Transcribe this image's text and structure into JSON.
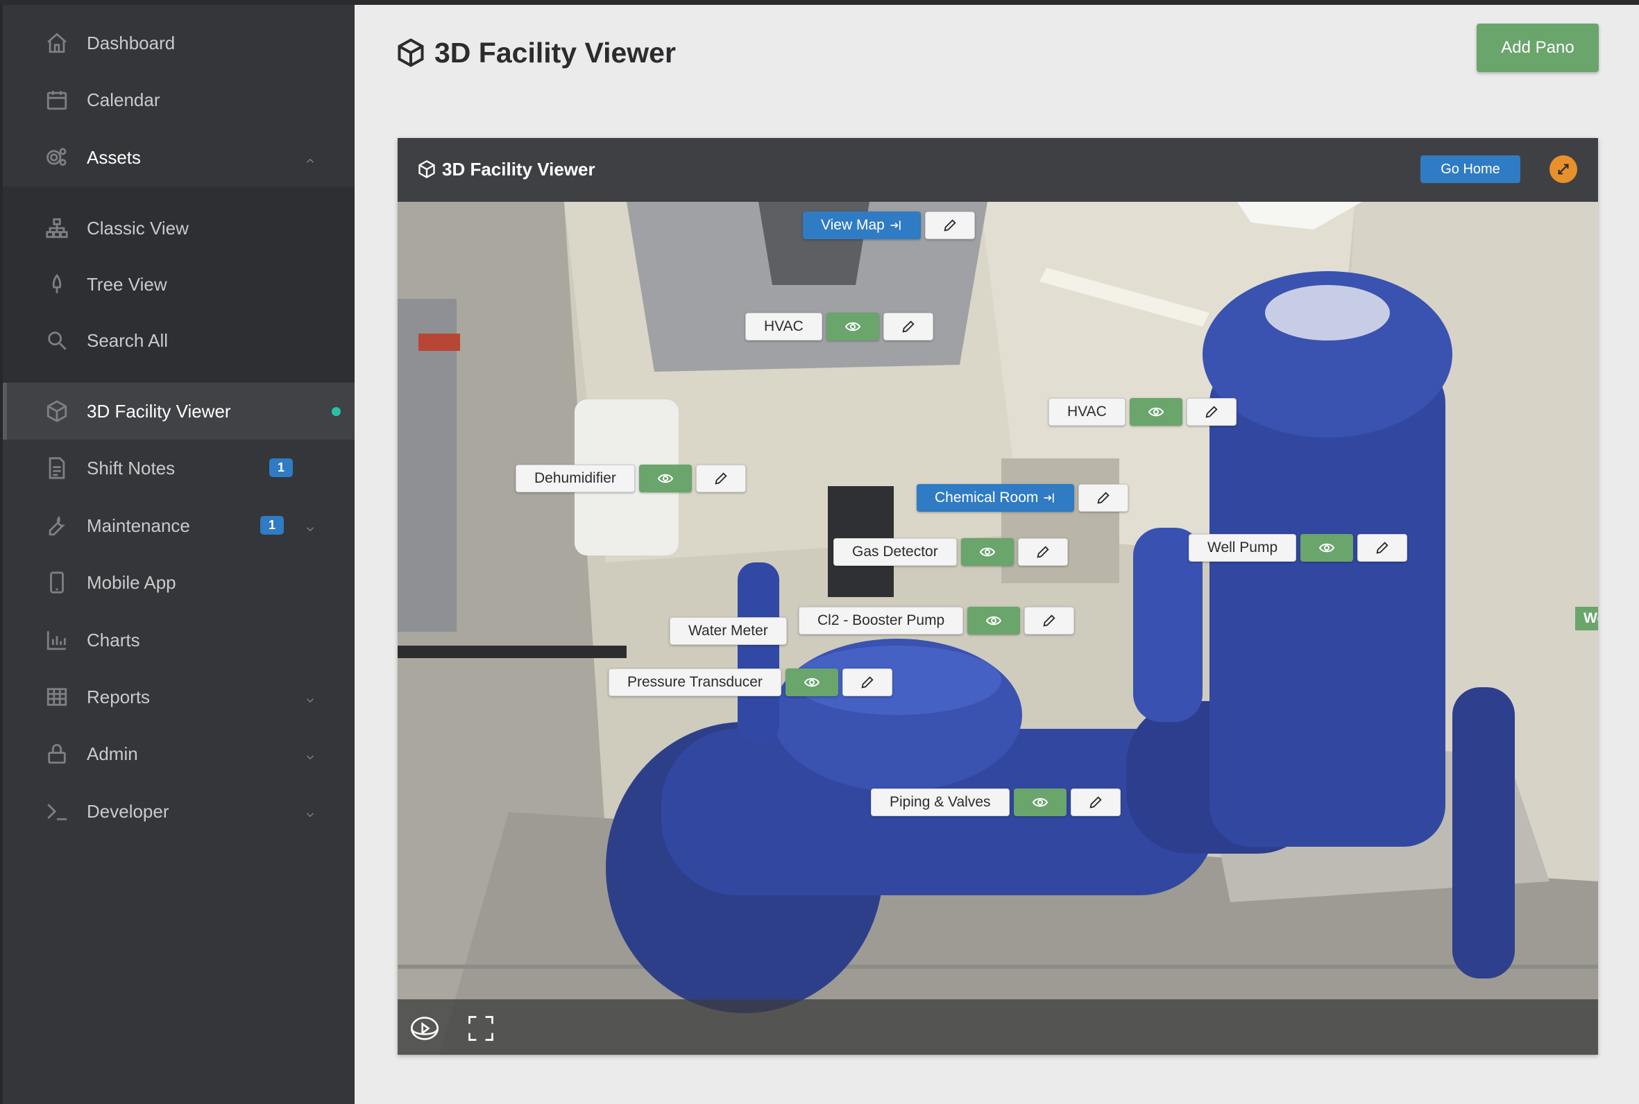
{
  "sidebar": {
    "items": [
      {
        "label": "Dashboard",
        "icon": "home-icon"
      },
      {
        "label": "Calendar",
        "icon": "calendar-icon"
      },
      {
        "label": "Assets",
        "icon": "gears-icon"
      },
      {
        "label": "Classic View",
        "icon": "hierarchy-icon"
      },
      {
        "label": "Tree View",
        "icon": "tree-icon"
      },
      {
        "label": "Search All",
        "icon": "search-icon"
      },
      {
        "label": "3D Facility Viewer",
        "icon": "cube-icon"
      },
      {
        "label": "Shift Notes",
        "icon": "document-icon",
        "badge": "1"
      },
      {
        "label": "Maintenance",
        "icon": "wrench-icon",
        "badge": "1"
      },
      {
        "label": "Mobile App",
        "icon": "phone-icon"
      },
      {
        "label": "Charts",
        "icon": "bar-chart-icon"
      },
      {
        "label": "Reports",
        "icon": "table-icon"
      },
      {
        "label": "Admin",
        "icon": "lock-icon"
      },
      {
        "label": "Developer",
        "icon": "terminal-icon"
      }
    ]
  },
  "header": {
    "title": "3D Facility Viewer",
    "add_pano_label": "Add Pano"
  },
  "viewer": {
    "title": "3D Facility Viewer",
    "go_home_label": "Go Home",
    "links": {
      "view_map": "View Map",
      "chemical_room": "Chemical Room"
    },
    "hotspots": {
      "hvac_1": "HVAC",
      "hvac_2": "HVAC",
      "dehumidifier": "Dehumidifier",
      "gas_detector": "Gas Detector",
      "well_pump": "Well Pump",
      "water_meter": "Water Meter",
      "cl2_booster_pump": "Cl2 - Booster Pump",
      "pressure_transducer": "Pressure Transducer",
      "piping_valves": "Piping & Valves"
    },
    "edge_tag": "We"
  },
  "colors": {
    "sidebar_bg": "#343639",
    "accent_green": "#6aa56c",
    "accent_blue": "#2f7bc4",
    "accent_orange": "#e8912a",
    "active_dot": "#28c2a0"
  }
}
